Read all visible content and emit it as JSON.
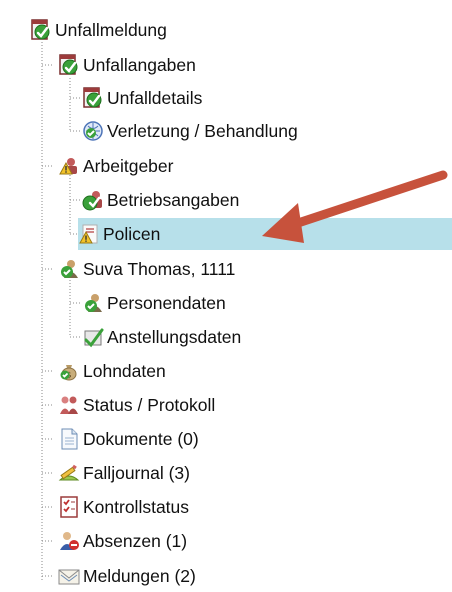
{
  "tree": {
    "items": [
      {
        "id": "unfallmeldung",
        "label": "Unfallmeldung",
        "icon": "report-check-icon"
      },
      {
        "id": "unfallangaben",
        "label": "Unfallangaben",
        "icon": "report-check-icon"
      },
      {
        "id": "unfalldetails",
        "label": "Unfalldetails",
        "icon": "report-check-icon"
      },
      {
        "id": "verletzung",
        "label": "Verletzung / Behandlung",
        "icon": "medical-globe-icon"
      },
      {
        "id": "arbeitgeber",
        "label": "Arbeitgeber",
        "icon": "employer-warning-icon"
      },
      {
        "id": "betriebsangaben",
        "label": "Betriebsangaben",
        "icon": "employer-check-icon"
      },
      {
        "id": "policen",
        "label": "Policen",
        "icon": "policy-warning-icon"
      },
      {
        "id": "suva_thomas",
        "label": "Suva Thomas, 1111",
        "icon": "person-check-icon"
      },
      {
        "id": "personendaten",
        "label": "Personendaten",
        "icon": "person-check-icon"
      },
      {
        "id": "anstellungsdaten",
        "label": "Anstellungsdaten",
        "icon": "employment-check-icon"
      },
      {
        "id": "lohndaten",
        "label": "Lohndaten",
        "icon": "money-bag-icon"
      },
      {
        "id": "status_protokoll",
        "label": "Status / Protokoll",
        "icon": "status-people-icon"
      },
      {
        "id": "dokumente",
        "label": "Dokumente (0)",
        "icon": "document-icon"
      },
      {
        "id": "falljournal",
        "label": "Falljournal (3)",
        "icon": "journal-pencil-icon"
      },
      {
        "id": "kontrollstatus",
        "label": "Kontrollstatus",
        "icon": "checklist-icon"
      },
      {
        "id": "absenzen",
        "label": "Absenzen (1)",
        "icon": "person-absence-icon"
      },
      {
        "id": "meldungen",
        "label": "Meldungen (2)",
        "icon": "envelope-icon"
      }
    ],
    "selected": "policen"
  },
  "colors": {
    "selection": "#b7e0ea",
    "arrow": "#c7523c",
    "check": "#3aa13a",
    "guide": "#8a8a8a"
  }
}
